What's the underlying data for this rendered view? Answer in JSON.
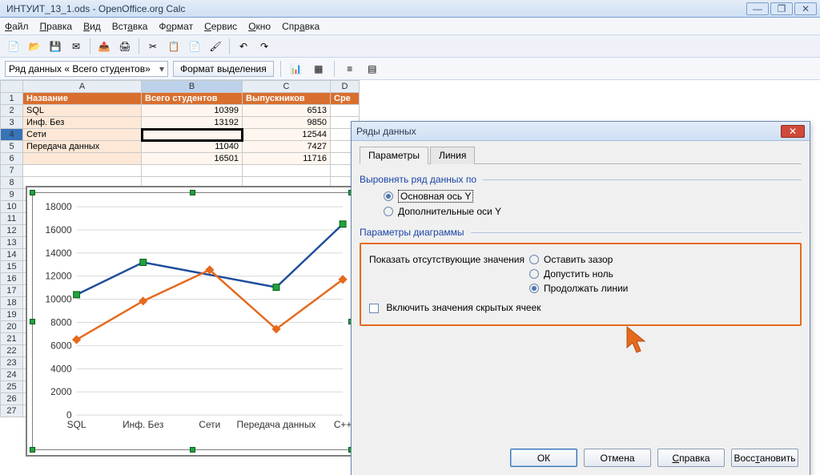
{
  "window": {
    "title": "ИНТУИТ_13_1.ods - OpenOffice.org Calc"
  },
  "menu": {
    "file": "Файл",
    "edit": "Правка",
    "view": "Вид",
    "insert": "Вставка",
    "format": "Формат",
    "tools": "Сервис",
    "window": "Окно",
    "help": "Справка"
  },
  "namebox": "Ряд данных « Всего студентов»",
  "formatSel": "Формат выделения",
  "columns": [
    "A",
    "B",
    "C",
    "D"
  ],
  "headers": {
    "A": "Название",
    "B": "Всего студентов",
    "C": "Выпускников",
    "D": "Сре"
  },
  "rows": [
    {
      "n": "1"
    },
    {
      "n": "2",
      "A": "SQL",
      "B": "10399",
      "C": "6513"
    },
    {
      "n": "3",
      "A": "Инф. Без",
      "B": "13192",
      "C": "9850"
    },
    {
      "n": "4",
      "A": "Сети",
      "B": "",
      "C": "12544"
    },
    {
      "n": "5",
      "A": "Передача данных",
      "B": "11040",
      "C": "7427"
    },
    {
      "n": "6",
      "A": "",
      "B": "16501",
      "C": "11716"
    }
  ],
  "extraRows": [
    "7",
    "8",
    "9",
    "10",
    "11",
    "12",
    "13",
    "14",
    "15",
    "16",
    "17",
    "18",
    "19",
    "20",
    "21",
    "22",
    "23",
    "24",
    "25",
    "26",
    "27"
  ],
  "dialog": {
    "title": "Ряды данных",
    "tabParams": "Параметры",
    "tabLine": "Линия",
    "alignLabel": "Выровнять ряд данных по",
    "axisPrimary": "Основная ось Y",
    "axisSecondary": "Дополнительные оси Y",
    "chartParamsLabel": "Параметры диаграммы",
    "missingLabel": "Показать отсутствующие значения",
    "optGap": "Оставить зазор",
    "optZero": "Допустить ноль",
    "optContinue": "Продолжать линии",
    "hiddenCells": "Включить значения скрытых ячеек",
    "ok": "ОК",
    "cancel": "Отмена",
    "helpBtn": "Справка",
    "reset": "Восстановить"
  },
  "chart_data": {
    "type": "line",
    "categories": [
      "SQL",
      "Инф. Без",
      "Сети",
      "Передача данных",
      "C++"
    ],
    "series": [
      {
        "name": "Всего студентов",
        "color": "#1f4e9c",
        "values": [
          10399,
          13192,
          null,
          11040,
          16501
        ]
      },
      {
        "name": "Выпускников",
        "color": "#e56a1e",
        "values": [
          6513,
          9850,
          12544,
          7427,
          11716
        ]
      }
    ],
    "ylim": [
      0,
      18000
    ],
    "yticks": [
      0,
      2000,
      4000,
      6000,
      8000,
      10000,
      12000,
      14000,
      16000,
      18000
    ],
    "title": "",
    "xlabel": "",
    "ylabel": ""
  }
}
